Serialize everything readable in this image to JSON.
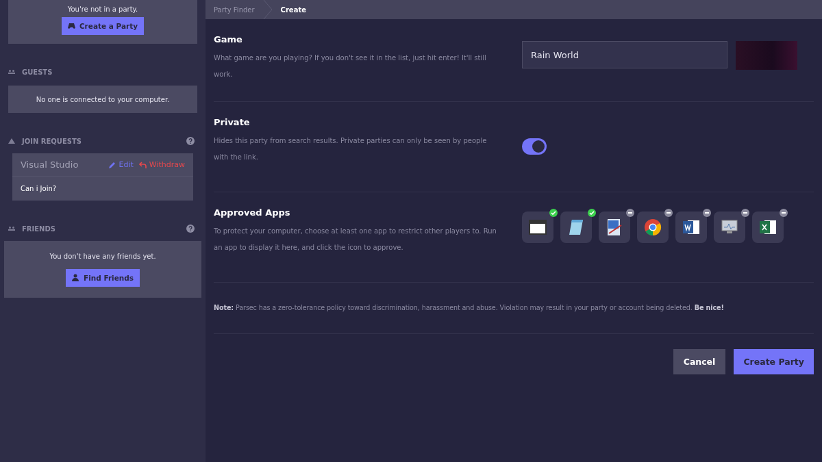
{
  "sidebar": {
    "party_card": {
      "message": "You're not in a party.",
      "button": "Create a Party"
    },
    "guests": {
      "title": "GUESTS",
      "message": "No one is connected to your computer."
    },
    "join_requests": {
      "title": "JOIN REQUESTS",
      "expanded": true,
      "items": [
        {
          "host": "Visual Studio",
          "edit": "Edit",
          "withdraw": "Withdraw",
          "message": "Can i Join?"
        }
      ]
    },
    "friends": {
      "title": "FRIENDS",
      "message": "You don't have any friends yet.",
      "button": "Find Friends"
    }
  },
  "breadcrumb": [
    {
      "label": "Party Finder",
      "selected": false
    },
    {
      "label": "Create",
      "selected": true
    }
  ],
  "form": {
    "game": {
      "title": "Game",
      "description": "What game are you playing? If you don't see it in the list, just hit enter! It'll still work.",
      "value": "Rain World"
    },
    "private": {
      "title": "Private",
      "description": "Hides this party from search results. Private parties can only be seen by people with the link.",
      "on": true
    },
    "approved_apps": {
      "title": "Approved Apps",
      "description": "To protect your computer, choose at least one app to restrict other players to. Run an app to display it here, and click the icon to approve.",
      "apps": [
        {
          "kind": "window",
          "approved": true
        },
        {
          "kind": "notepad",
          "approved": true
        },
        {
          "kind": "paint",
          "approved": false
        },
        {
          "kind": "chrome",
          "approved": false
        },
        {
          "kind": "word",
          "approved": false
        },
        {
          "kind": "monitor",
          "approved": false
        },
        {
          "kind": "excel",
          "approved": false
        }
      ]
    },
    "note": "**Note:** Parsec has a zero-tolerance policy toward discrimination, harassment and abuse. Violation may result in your party or account being deleted. **Be nice!**",
    "buttons": [
      {
        "kind": "secondary",
        "label": "Cancel"
      },
      {
        "kind": "primary",
        "label": "Create Party"
      }
    ]
  }
}
